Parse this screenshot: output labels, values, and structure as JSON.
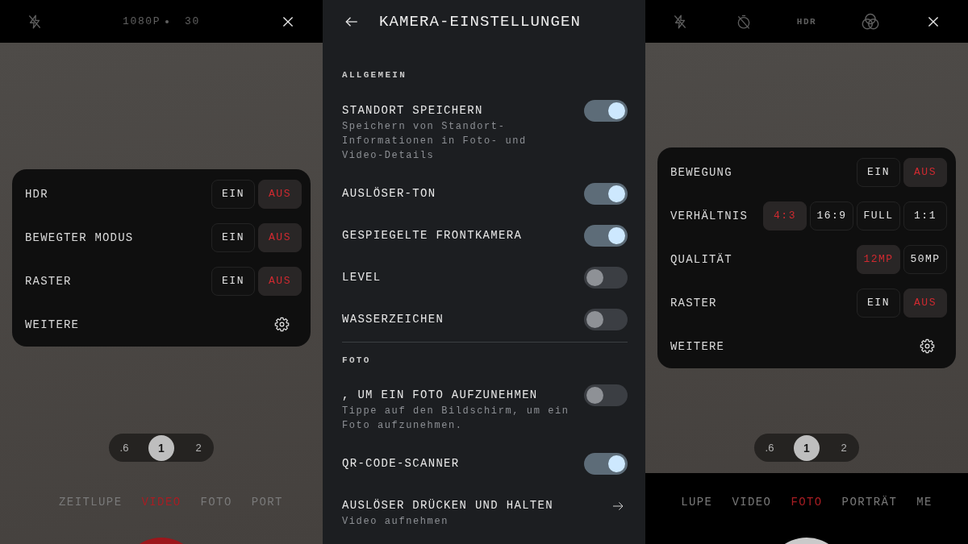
{
  "screens": [
    {
      "kind": "camera_video",
      "top_bar": [
        {
          "kind": "flash",
          "on": false
        },
        {
          "kind": "video_format",
          "resolution": "1080P",
          "frame_rate": "30"
        },
        {
          "kind": "close"
        }
      ],
      "quick_settings": [
        {
          "kind": "choice",
          "label": "HDR",
          "options": [
            {
              "label": "EIN",
              "selected": false
            },
            {
              "label": "AUS",
              "selected": true
            }
          ]
        },
        {
          "kind": "choice",
          "label": "BEWEGTER MODUS",
          "options": [
            {
              "label": "EIN",
              "selected": false
            },
            {
              "label": "AUS",
              "selected": true
            }
          ]
        },
        {
          "kind": "choice",
          "label": "RASTER",
          "options": [
            {
              "label": "EIN",
              "selected": false
            },
            {
              "label": "AUS",
              "selected": true
            }
          ]
        },
        {
          "kind": "more",
          "label": "WEITERE"
        }
      ],
      "zoom_levels": [
        {
          "label": ".6",
          "selected": false
        },
        {
          "label": "1",
          "selected": true
        },
        {
          "label": "2",
          "selected": false
        }
      ],
      "modes": [
        {
          "label": "ZEITLUPE",
          "selected": false
        },
        {
          "label": "VIDEO",
          "selected": true
        },
        {
          "label": "FOTO",
          "selected": false
        },
        {
          "label": "PORT",
          "selected": false
        }
      ]
    },
    {
      "kind": "settings",
      "title": "KAMERA-EINSTELLUNGEN",
      "sections": [
        {
          "heading": "ALLGEMEIN",
          "items": [
            {
              "kind": "toggle",
              "title": "STANDORT SPEICHERN",
              "description": "Speichern von Standort-Informationen in Foto- und Video-Details",
              "on": true
            },
            {
              "kind": "toggle",
              "title": "AUSLÖSER-TON",
              "on": true
            },
            {
              "kind": "toggle",
              "title": "GESPIEGELTE FRONTKAMERA",
              "on": true
            },
            {
              "kind": "toggle",
              "title": "LEVEL",
              "on": false
            },
            {
              "kind": "toggle",
              "title": "WASSERZEICHEN",
              "on": false
            }
          ]
        },
        {
          "heading": "FOTO",
          "items": [
            {
              "kind": "toggle",
              "title": ", UM EIN FOTO AUFZUNEHMEN",
              "description": "Tippe auf den Bildschirm, um ein Foto aufzunehmen.",
              "on": false
            },
            {
              "kind": "toggle",
              "title": "QR-CODE-SCANNER",
              "on": true
            },
            {
              "kind": "link",
              "title": "AUSLÖSER DRÜCKEN UND HALTEN",
              "description": "Video aufnehmen"
            }
          ]
        }
      ]
    },
    {
      "kind": "camera_photo",
      "top_bar": [
        {
          "kind": "flash",
          "on": false
        },
        {
          "kind": "timer",
          "on": false
        },
        {
          "kind": "label",
          "text": "HDR"
        },
        {
          "kind": "filters"
        },
        {
          "kind": "close"
        }
      ],
      "quick_settings": [
        {
          "kind": "choice",
          "label": "BEWEGUNG",
          "options": [
            {
              "label": "EIN",
              "selected": false
            },
            {
              "label": "AUS",
              "selected": true
            }
          ]
        },
        {
          "kind": "choice",
          "label": "VERHÄLTNIS",
          "options": [
            {
              "label": "4:3",
              "selected": true
            },
            {
              "label": "16:9",
              "selected": false
            },
            {
              "label": "FULL",
              "selected": false
            },
            {
              "label": "1:1",
              "selected": false
            }
          ]
        },
        {
          "kind": "choice",
          "label": "QUALITÄT",
          "options": [
            {
              "label": "12MP",
              "selected": true
            },
            {
              "label": "50MP",
              "selected": false
            }
          ]
        },
        {
          "kind": "choice",
          "label": "RASTER",
          "options": [
            {
              "label": "EIN",
              "selected": false
            },
            {
              "label": "AUS",
              "selected": true
            }
          ]
        },
        {
          "kind": "more",
          "label": "WEITERE"
        }
      ],
      "zoom_levels": [
        {
          "label": ".6",
          "selected": false
        },
        {
          "label": "1",
          "selected": true
        },
        {
          "label": "2",
          "selected": false
        }
      ],
      "modes": [
        {
          "label": "LUPE",
          "selected": false
        },
        {
          "label": "VIDEO",
          "selected": false
        },
        {
          "label": "FOTO",
          "selected": true
        },
        {
          "label": "PORTRÄT",
          "selected": false
        },
        {
          "label": "ME",
          "selected": false
        }
      ]
    }
  ]
}
